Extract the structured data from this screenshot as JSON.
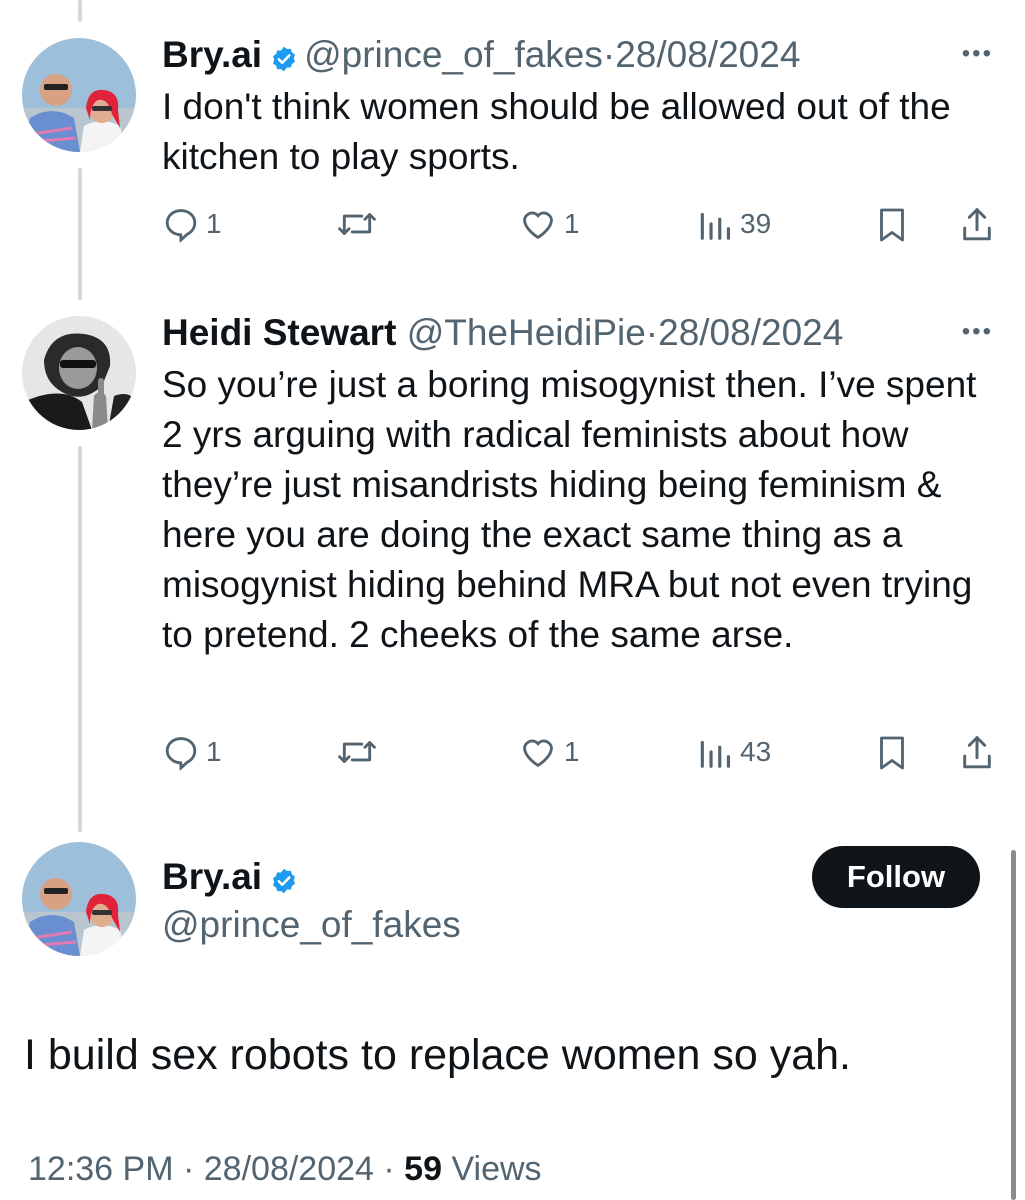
{
  "colors": {
    "text": "#0f1419",
    "secondary": "#536471",
    "verified": "#1d9bf0",
    "thread_line": "#cfd9de"
  },
  "tweets": [
    {
      "name": "Bry.ai",
      "verified": true,
      "handle": "@prince_of_fakes",
      "separator": "·",
      "date": "28/08/2024",
      "more": "•••",
      "text": "I don't think women should be allowed out of the kitchen to play sports.",
      "actions": {
        "replies": "1",
        "likes": "1",
        "views": "39"
      },
      "icons": [
        "reply-icon",
        "retweet-icon",
        "like-icon",
        "views-icon",
        "bookmark-icon",
        "share-icon"
      ]
    },
    {
      "name": "Heidi Stewart",
      "verified": false,
      "handle": "@TheHeidiPie",
      "separator": "·",
      "date": "28/08/2024",
      "more": "•••",
      "text": "So you’re just a boring misogynist then. I’ve spent 2 yrs arguing with radical feminists about how they’re just misandrists hiding being feminism & here you are doing the exact same thing as a misogynist hiding behind MRA but not even trying to pretend. 2 cheeks of the same arse.",
      "actions": {
        "replies": "1",
        "likes": "1",
        "views": "43"
      },
      "icons": [
        "reply-icon",
        "retweet-icon",
        "like-icon",
        "views-icon",
        "bookmark-icon",
        "share-icon"
      ]
    }
  ],
  "main_tweet": {
    "name": "Bry.ai",
    "verified": true,
    "handle": "@prince_of_fakes",
    "follow_label": "Follow",
    "text": "I build sex robots to replace women so yah.",
    "time": "12:36 PM",
    "separator": "·",
    "date": "28/08/2024",
    "views_count": "59",
    "views_label": "Views"
  }
}
